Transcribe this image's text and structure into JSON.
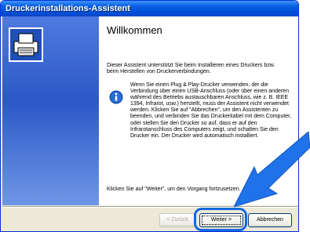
{
  "window": {
    "title": "Druckerinstallations-Assistent"
  },
  "content": {
    "heading": "Willkommen",
    "intro": "Dieser Assistent unterstützt Sie beim Installieren eines Druckers bzw. beim Herstellen von Druckerverbindungen.",
    "info": "Wenn Sie einen Plug & Play-Drucker verwenden, der die Verbindung über einen USB-Anschluss (oder über einen anderen während des Betriebs austauschbaren Anschluss, wie z. B. IEEE 1394, Infrarot, usw.) herstellt, muss der Assistent nicht verwendet werden. Klicken Sie auf \"Abbrechen\", um den Assistenten zu beenden, und verbinden Sie das Druckerkabel mit dem Computer, oder stellen Sie den Drucker so auf, dass er auf den Infrarotanschluss des Computers zeigt, und schalten Sie den Drucker ein. Der Drucker wird automatisch installiert.",
    "continue": "Klicken Sie auf \"Weiter\", um den Vorgang fortzusetzen."
  },
  "buttons": {
    "back": "< Zurück",
    "next": "Weiter >",
    "cancel": "Abbrechen"
  },
  "colors": {
    "accent": "#1468e0",
    "titlebar": "#0050d8"
  },
  "icons": [
    "printer-icon",
    "info-icon",
    "pointer-arrow-icon"
  ]
}
